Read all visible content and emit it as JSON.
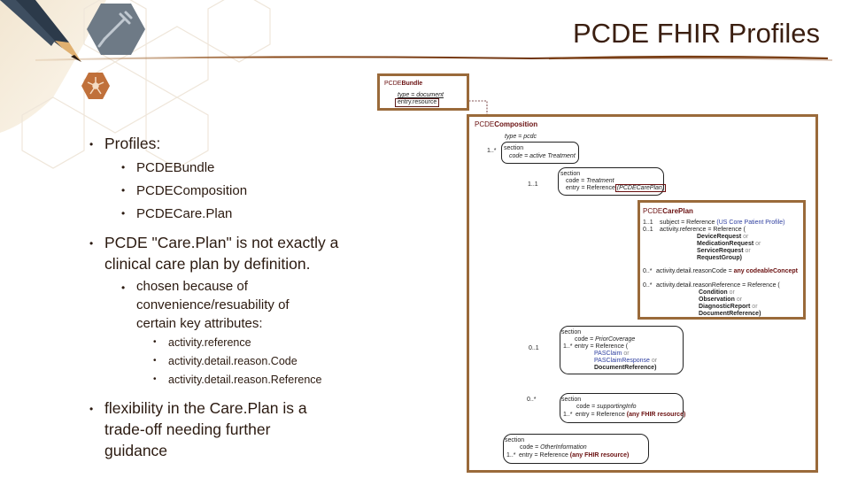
{
  "slide": {
    "title": "PCDE FHIR Profiles",
    "icons": [
      "syringe-icon",
      "network-icon",
      "pencil-icon"
    ]
  },
  "bullets": {
    "profiles": {
      "label": "Profiles:",
      "items": [
        "PCDEBundle",
        "PCDEComposition",
        "PCDECare.Plan"
      ]
    },
    "careplan_note": {
      "line1": "PCDE \"Care.Plan\" is not exactly a",
      "line2": "clinical care plan by definition.",
      "sub": {
        "line1": "chosen because of",
        "line2": "convenience/resuability of",
        "line3": "certain key attributes:",
        "items": [
          "activity.reference",
          "activity.detail.reason.Code",
          "activity.detail.reason.Reference"
        ]
      }
    },
    "flexibility": {
      "line1": "flexibility in the Care.Plan  is a",
      "line2": "trade-off needing further",
      "line3": "guidance"
    }
  },
  "diagram": {
    "bundle": {
      "prefix": "PCDE",
      "name": "Bundle",
      "type_line": "type = document",
      "entry_line": "entry.resource"
    },
    "composition": {
      "prefix": "PCDE",
      "name": "Composition",
      "type_line": "type = pcdc",
      "section_card": "1..*",
      "section": {
        "label": "section",
        "code": "code = active Treatment"
      },
      "treatment_card": "1..1",
      "treatment": {
        "label": "section",
        "code_prefix": "code = ",
        "code_val": "Treatment",
        "entry_prefix": "entry = Reference",
        "entry_ref": "(PCDECarePlan)"
      },
      "prior_card": "0..1",
      "prior": {
        "label": "section",
        "code_prefix": "code = ",
        "code_val": "PriorCoverage",
        "entry_card": "1..*",
        "entry_prefix": "entry = Reference (",
        "refs": [
          "PASClaim",
          "PASClaimResponse",
          "DocumentReference)"
        ],
        "or": "or"
      },
      "support_card": "0..*",
      "support": {
        "label": "section",
        "code_prefix": "code = ",
        "code_val": "supportingInfo",
        "entry_card": "1..*",
        "entry_prefix": "entry = Reference ",
        "entry_ref": "(any FHIR resource)"
      },
      "other": {
        "label": "section",
        "code_prefix": "code = ",
        "code_val": "OtherInformation",
        "entry_card": "1..*",
        "entry_prefix": "entry = Reference ",
        "entry_ref": "(any FHIR resource)"
      }
    },
    "careplan": {
      "prefix": "PCDE",
      "name": "CarePlan",
      "subject_card": "1..1",
      "subject_prefix": "subject = Reference ",
      "subject_ref": "(US Core Patient Profile)",
      "activity_card": "0..1",
      "activity_prefix": "activity.reference = Reference (",
      "activity_refs": [
        "DeviceRequest",
        "MedicationRequest",
        "ServiceRequest",
        "RequestGroup)"
      ],
      "reason_code_card": "0..*",
      "reason_code_prefix": "activity.detail.reasonCode = ",
      "reason_code_val": "any codeableConcept",
      "reason_ref_card": "0..*",
      "reason_ref_prefix": "activity.detail.reasonReference = Reference (",
      "reason_refs": [
        "Condition",
        "Observation",
        "DiagnosticReport",
        "DocumentReference)"
      ],
      "or": "or"
    }
  }
}
